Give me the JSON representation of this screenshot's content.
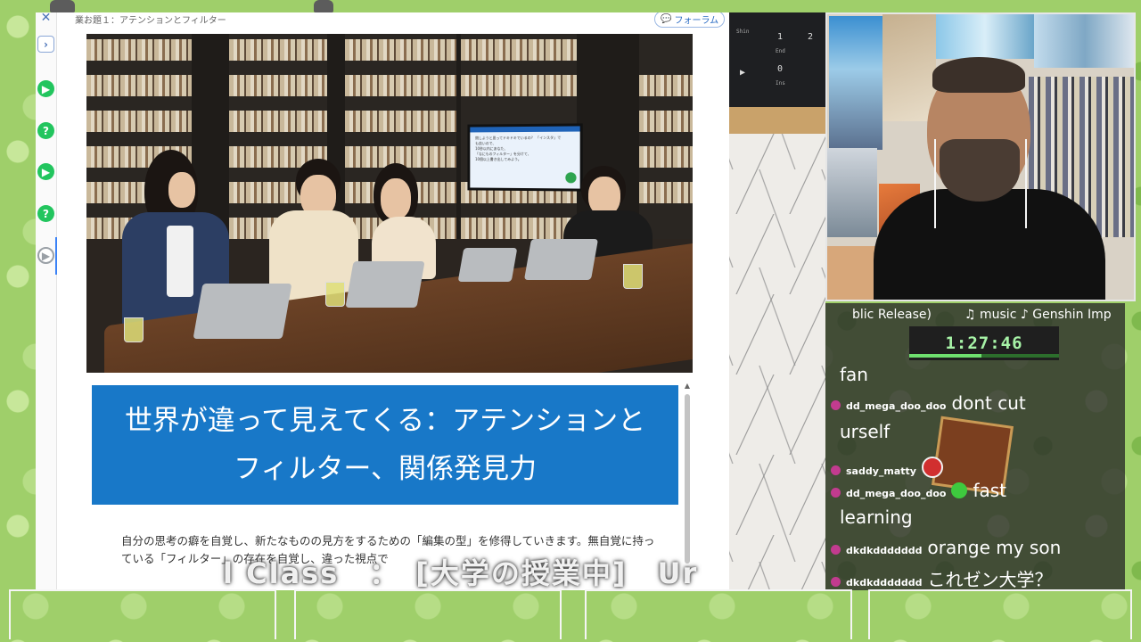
{
  "page": {
    "breadcrumb": "業お題１：アテンションとフィルター",
    "forum_button": "フォーラム",
    "heading_lines": [
      "世界が違って見えてくる：アテンションと",
      "フィルター、関係発見力"
    ],
    "body_text": "自分の思考の癖を自覚し、新たなものの見方をするための「編集の型」を修得していきます。無自覚に持っている「フィルター」の存在を自覚し、違った視点で",
    "tv_screen_text": "問しようと思ってドキドキでいるの？ 「インスタ」でも良いので、\n10秒以内にあなた、\n「なにものフィルター」を分けて、\n10個以上書き出してみよう。"
  },
  "caption": {
    "text": "l Class　：　[大学の授業中]　Ur"
  },
  "pad": {
    "shin_label": "Shin",
    "key_1": "1",
    "key_2": "2",
    "key_1_sub": "End",
    "key_0": "0",
    "key_0_sub": "Ins"
  },
  "stream": {
    "now_playing_left": "blic Release)",
    "now_playing_right": "♫ music ♪ Genshin Imp",
    "timer": "1:27:46",
    "timer_progress": 0.48
  },
  "chat": [
    {
      "user": "",
      "message": "fan"
    },
    {
      "user": "dd_mega_doo_doo",
      "message": "dont cut"
    },
    {
      "user": "",
      "message": "urself"
    },
    {
      "user": "saddy_matty",
      "message": ""
    },
    {
      "user": "dd_mega_doo_doo",
      "message": "fast"
    },
    {
      "user": "",
      "message": "learning"
    },
    {
      "user": "dkdkddddddd",
      "message": "orange my son"
    },
    {
      "user": "dkdkddddddd",
      "message": "これゼン大学？"
    }
  ],
  "colors": {
    "banner_blue": "#1878c8",
    "rail_green": "#22c55e",
    "chat_badge": "#c23b8f",
    "timer_green": "#a7f3a7"
  },
  "icons": {
    "rail": [
      "close-icon",
      "chevron-right-icon",
      "play-circle-icon",
      "help-circle-icon",
      "play-circle-icon",
      "help-circle-icon",
      "play-circle-icon"
    ],
    "forum": "speech-bubble-icon"
  }
}
